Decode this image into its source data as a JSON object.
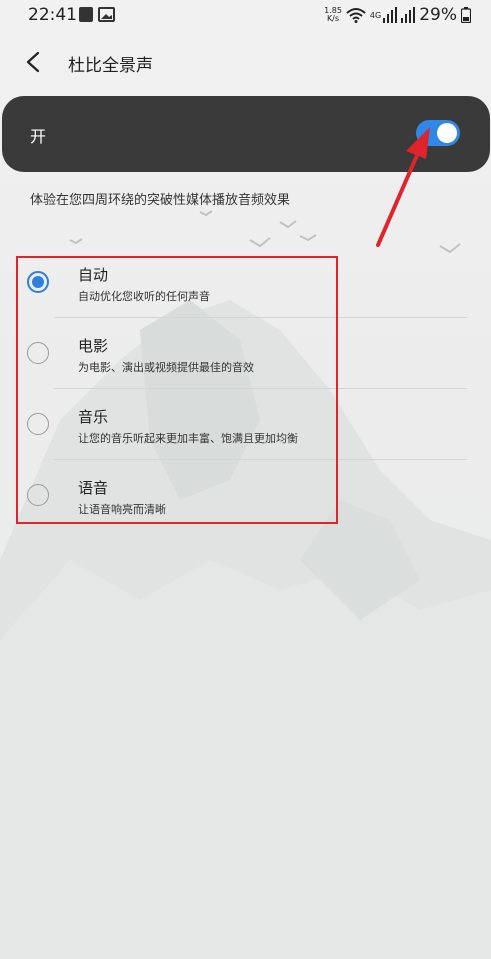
{
  "status_bar": {
    "time": "22:41",
    "speed": "1.85",
    "speed_unit": "K/s",
    "network": "4G",
    "battery": "29%"
  },
  "header": {
    "title": "杜比全景声"
  },
  "main_toggle": {
    "label": "开",
    "state": "on",
    "accent_color": "#2f87e8"
  },
  "description": "体验在您四周环绕的突破性媒体播放音频效果",
  "options": [
    {
      "title": "自动",
      "subtitle": "自动优化您收听的任何声音",
      "selected": true
    },
    {
      "title": "电影",
      "subtitle": "为电影、演出或视频提供最佳的音效",
      "selected": false
    },
    {
      "title": "音乐",
      "subtitle": "让您的音乐听起来更加丰富、饱满且更加均衡",
      "selected": false
    },
    {
      "title": "语音",
      "subtitle": "让语音响亮而清晰",
      "selected": false
    }
  ],
  "annotation_color": "#e0242c"
}
